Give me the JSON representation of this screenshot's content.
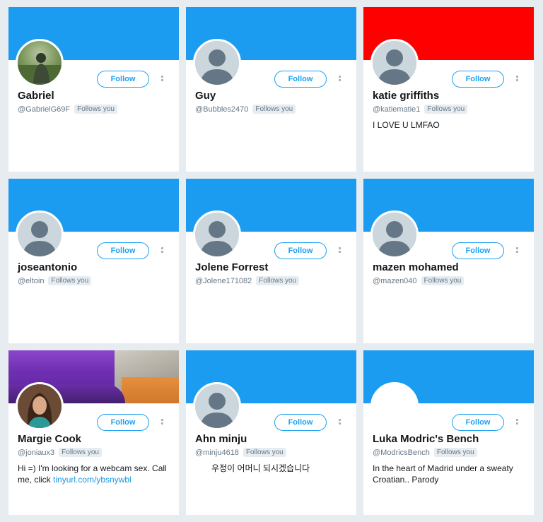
{
  "colors": {
    "accent": "#1da1f2",
    "banner_blue": "#1b9cf0",
    "banner_red": "#ff0000",
    "page_bg": "#e6ecf0"
  },
  "follow_label": "Follow",
  "follows_you_label": "Follows you",
  "cards": [
    {
      "name": "Gabriel",
      "handle": "@GabrielG69F",
      "follows_you": true,
      "bio": "",
      "banner": "blue",
      "avatar": "photo"
    },
    {
      "name": "Guy",
      "handle": "@Bubbles2470",
      "follows_you": true,
      "bio": "",
      "banner": "blue",
      "avatar": "default"
    },
    {
      "name": "katie griffiths",
      "handle": "@katiematie1",
      "follows_you": true,
      "bio": "I LOVE U LMFAO",
      "banner": "red",
      "avatar": "default"
    },
    {
      "name": "joseantonio",
      "handle": "@eltoin",
      "follows_you": true,
      "bio": "",
      "banner": "blue",
      "avatar": "default"
    },
    {
      "name": "Jolene Forrest",
      "handle": "@Jolene171082",
      "follows_you": true,
      "bio": "",
      "banner": "blue",
      "avatar": "default"
    },
    {
      "name": "mazen mohamed",
      "handle": "@mazen040",
      "follows_you": true,
      "bio": "",
      "banner": "blue",
      "avatar": "default"
    },
    {
      "name": "Margie Cook",
      "handle": "@joniaux3",
      "follows_you": true,
      "bio": "Hi =) I'm looking for a webcam sex. Call me, click ",
      "bio_link": "tinyurl.com/ybsnywbl",
      "banner": "photo",
      "avatar": "photo"
    },
    {
      "name": "Ahn minju",
      "handle": "@minju4618",
      "follows_you": true,
      "bio": "우정이 어머니 되시겠습니다",
      "banner": "blue",
      "avatar": "default"
    },
    {
      "name": "Luka Modric's Bench",
      "handle": "@ModricsBench",
      "follows_you": true,
      "bio": "In the heart of Madrid under a sweaty Croatian.. Parody",
      "banner": "blue",
      "avatar": "blank"
    }
  ]
}
